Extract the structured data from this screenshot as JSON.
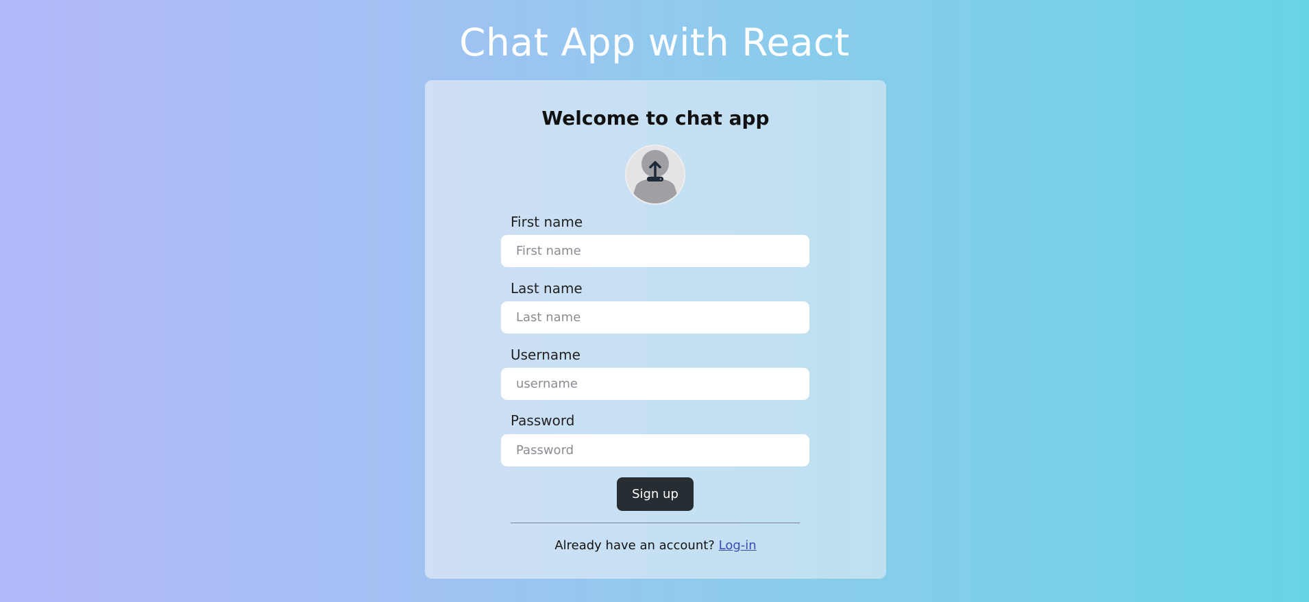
{
  "app": {
    "title": "Chat App with React"
  },
  "signup_form": {
    "heading": "Welcome to chat app",
    "avatar_icon": "avatar-upload-icon",
    "fields": [
      {
        "label": "First name",
        "placeholder": "First name",
        "value": ""
      },
      {
        "label": "Last name",
        "placeholder": "Last name",
        "value": ""
      },
      {
        "label": "Username",
        "placeholder": "username",
        "value": ""
      },
      {
        "label": "Password",
        "placeholder": "Password",
        "value": ""
      }
    ],
    "submit_label": "Sign up",
    "footer_text": "Already have an account?",
    "login_link": "Log-in"
  },
  "colors": {
    "gradient_start": "#b3b8f8",
    "gradient_end": "#68d5e5",
    "button_bg": "#262d33",
    "link": "#3a49b0"
  }
}
